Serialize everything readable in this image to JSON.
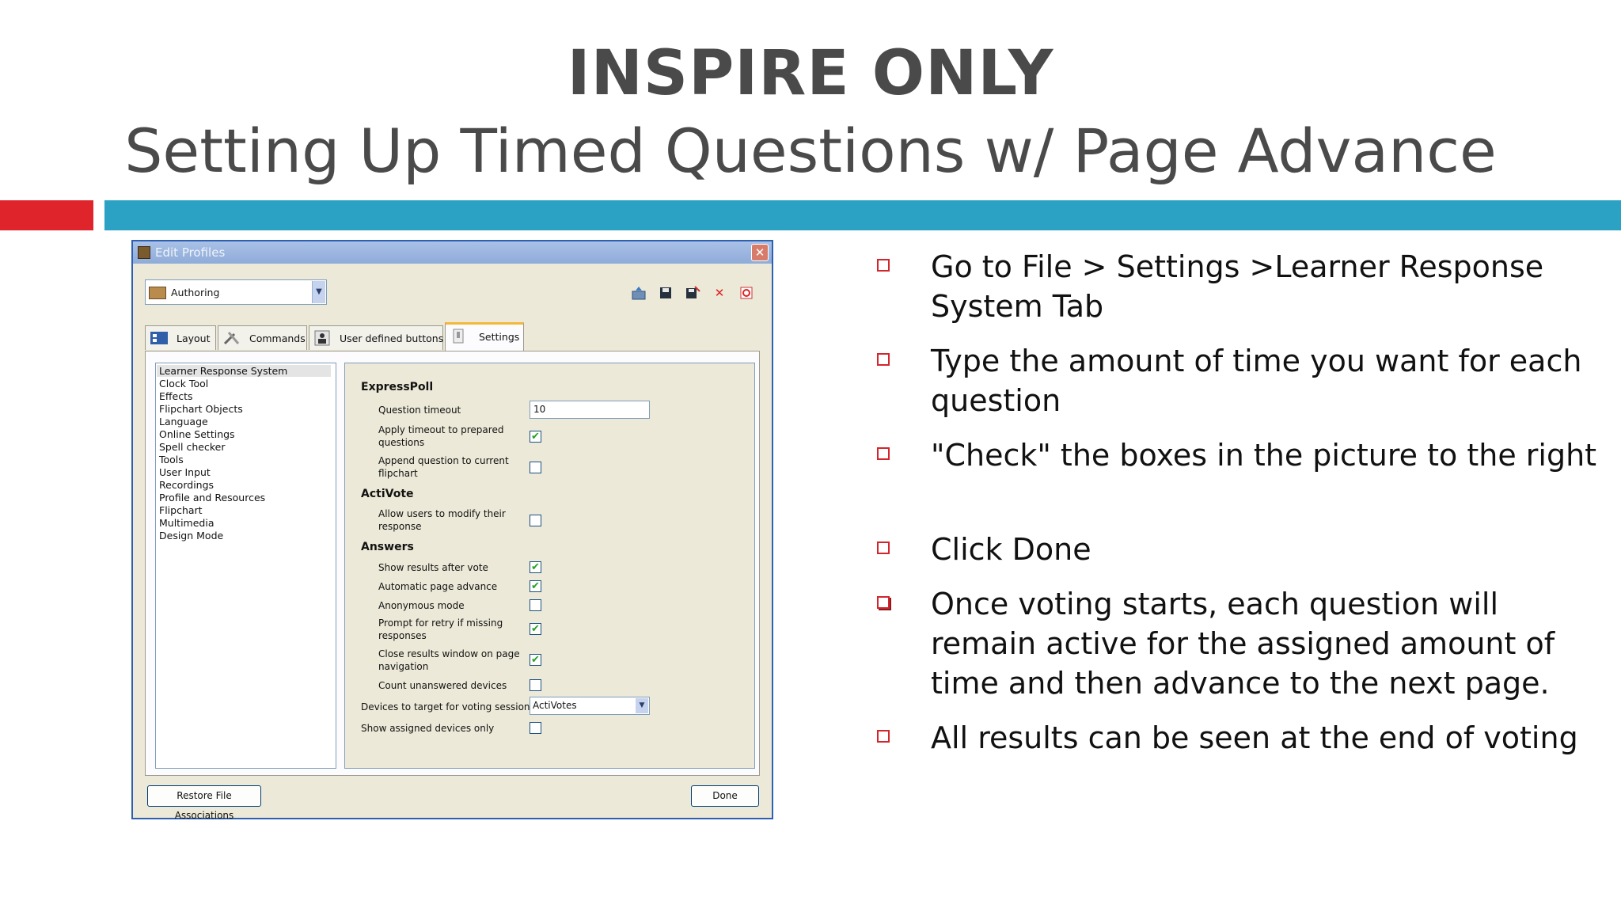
{
  "slide": {
    "title": "INSPIRE ONLY",
    "subtitle": "Setting Up Timed Questions w/ Page Advance",
    "accent_colors": {
      "red": "#e0242c",
      "blue": "#2ba2c4"
    }
  },
  "dialog": {
    "title": "Edit Profiles",
    "close_symbol": "✕",
    "profile": "Authoring",
    "toolbar_icons": [
      "export-icon",
      "save-icon",
      "save-as-icon",
      "delete-icon",
      "reset-icon"
    ],
    "tabs": [
      {
        "label": "Layout",
        "icon": "layout-icon"
      },
      {
        "label": "Commands",
        "icon": "tools-icon"
      },
      {
        "label": "User defined buttons",
        "icon": "user-icon"
      },
      {
        "label": "Settings",
        "icon": "settings-icon"
      }
    ],
    "active_tab": "Settings",
    "categories": [
      "Learner Response System",
      "Clock Tool",
      "Effects",
      "Flipchart Objects",
      "Language",
      "Online Settings",
      "Spell checker",
      "Tools",
      "User Input",
      "Recordings",
      "Profile and Resources",
      "Flipchart",
      "Multimedia",
      "Design Mode"
    ],
    "selected_category": "Learner Response System",
    "settings": {
      "expresspoll_heading": "ExpressPoll",
      "question_timeout_label": "Question timeout",
      "question_timeout_value": "10",
      "apply_timeout_label": "Apply timeout to prepared questions",
      "apply_timeout_checked": true,
      "append_question_label": "Append question to current flipchart",
      "append_question_checked": false,
      "activote_heading": "ActiVote",
      "allow_modify_label": "Allow users to modify their response",
      "allow_modify_checked": false,
      "answers_heading": "Answers",
      "show_results_label": "Show results after vote",
      "show_results_checked": true,
      "auto_advance_label": "Automatic page advance",
      "auto_advance_checked": true,
      "anonymous_label": "Anonymous mode",
      "anonymous_checked": false,
      "prompt_retry_label": "Prompt for retry if missing responses",
      "prompt_retry_checked": true,
      "close_results_label": "Close results window on page navigation",
      "close_results_checked": true,
      "count_unanswered_label": "Count unanswered devices",
      "count_unanswered_checked": false,
      "devices_target_label": "Devices to target for voting sessions",
      "devices_target_value": "ActiVotes",
      "show_assigned_label": "Show assigned devices only",
      "show_assigned_checked": false
    },
    "check_mark": "✔",
    "restore_button": "Restore File Associations",
    "done_button": "Done"
  },
  "bullets": [
    "Go to File > Settings >Learner Response System Tab",
    "Type the amount of time you want for each question",
    "\"Check\" the boxes in the picture to the right",
    "Click Done",
    "Once voting starts, each question will remain active for the assigned amount of time and then advance to the next page.",
    "All results can be seen at the end of voting"
  ]
}
